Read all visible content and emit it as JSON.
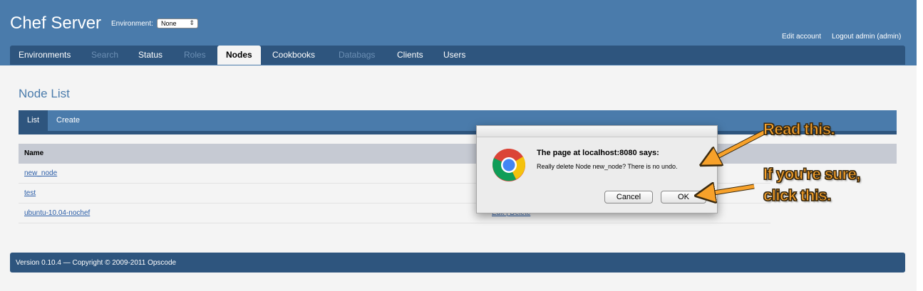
{
  "header": {
    "site_title": "Chef Server",
    "env_label": "Environment:",
    "env_selected": "None",
    "edit_account": "Edit account",
    "logout": "Logout admin (admin)"
  },
  "nav": {
    "items": [
      {
        "label": "Environments",
        "state": "normal"
      },
      {
        "label": "Search",
        "state": "disabled"
      },
      {
        "label": "Status",
        "state": "normal"
      },
      {
        "label": "Roles",
        "state": "disabled"
      },
      {
        "label": "Nodes",
        "state": "active"
      },
      {
        "label": "Cookbooks",
        "state": "normal"
      },
      {
        "label": "Databags",
        "state": "disabled"
      },
      {
        "label": "Clients",
        "state": "normal"
      },
      {
        "label": "Users",
        "state": "normal"
      }
    ]
  },
  "main": {
    "page_title": "Node List",
    "subtabs": [
      {
        "label": "List",
        "active": true
      },
      {
        "label": "Create",
        "active": false
      }
    ],
    "table": {
      "column_name": "Name",
      "rows": [
        {
          "name": "new_node",
          "actions": ""
        },
        {
          "name": "test",
          "actions": ""
        },
        {
          "name": "ubuntu-10.04-nochef",
          "actions": "Edit | Delete"
        }
      ]
    }
  },
  "footer": {
    "text": "Version 0.10.4 — Copyright © 2009-2011 Opscode"
  },
  "dialog": {
    "title": "The page at localhost:8080 says:",
    "message": "Really delete Node new_node?  There is no undo.",
    "cancel_label": "Cancel",
    "ok_label": "OK",
    "icon": "chrome-icon"
  },
  "annotations": {
    "read": "Read this.",
    "sure_line1": "If you're sure,",
    "sure_line2": "click this.",
    "color": "#f7a12a"
  },
  "colors": {
    "header_bg": "#4a7bab",
    "nav_bg": "#2e557e",
    "link": "#2a5da7"
  }
}
